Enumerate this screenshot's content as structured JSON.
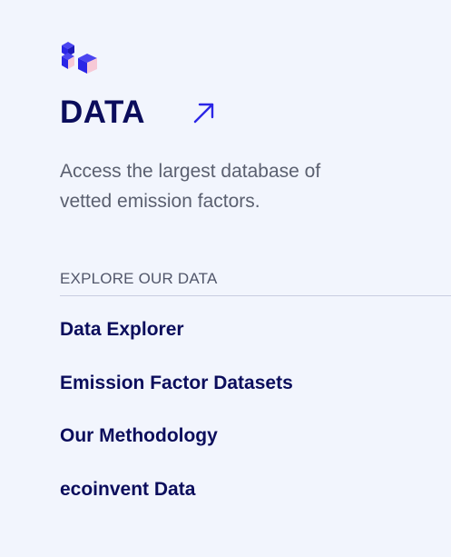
{
  "panel": {
    "title": "DATA",
    "description": "Access the largest database of vetted emission factors.",
    "section_label": "EXPLORE OUR DATA",
    "links": [
      {
        "label": "Data Explorer"
      },
      {
        "label": "Emission Factor Datasets"
      },
      {
        "label": "Our Methodology"
      },
      {
        "label": "ecoinvent Data"
      }
    ]
  },
  "icons": {
    "logo": "cubes-logo-icon",
    "title_link": "arrow-up-right-icon"
  },
  "colors": {
    "background": "#f2f5fd",
    "heading": "#0b0d5c",
    "body_text": "#5b6070",
    "accent_blue": "#2b25e6",
    "accent_pink": "#f7c9d6"
  }
}
